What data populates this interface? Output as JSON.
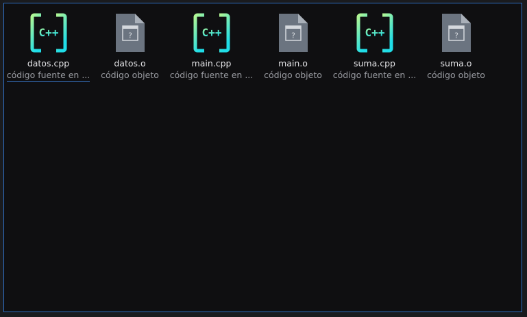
{
  "files": [
    {
      "name": "datos.cpp",
      "type": "código fuente en ...",
      "icon": "cpp-file-icon"
    },
    {
      "name": "datos.o",
      "type": "código objeto",
      "icon": "object-file-icon"
    },
    {
      "name": "main.cpp",
      "type": "código fuente en ...",
      "icon": "cpp-file-icon"
    },
    {
      "name": "main.o",
      "type": "código objeto",
      "icon": "object-file-icon"
    },
    {
      "name": "suma.cpp",
      "type": "código fuente en ...",
      "icon": "cpp-file-icon"
    },
    {
      "name": "suma.o",
      "type": "código objeto",
      "icon": "object-file-icon"
    }
  ],
  "colors": {
    "background": "#0f0f11",
    "selection_border": "#2f6fc4",
    "cpp_gradient_top": "#a6f59a",
    "cpp_gradient_bottom": "#2de0e6",
    "object_icon": "#6b7480"
  }
}
